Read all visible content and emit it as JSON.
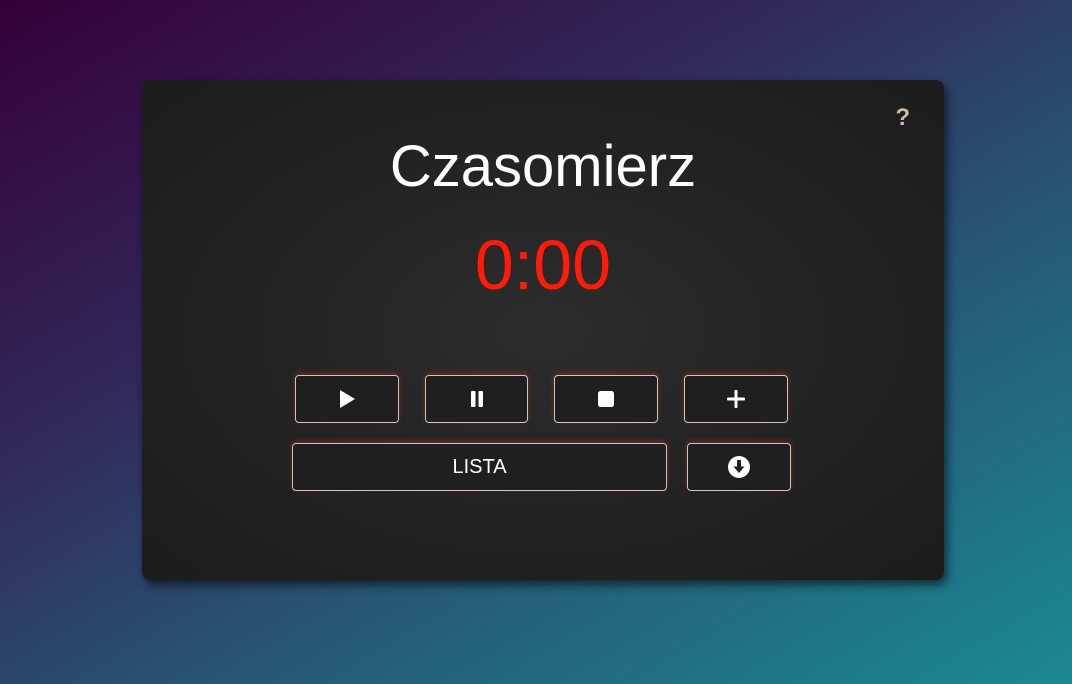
{
  "app": {
    "title": "Czasomierz",
    "time": "0:00",
    "help_label": "?"
  },
  "controls": {
    "play_icon": "play-icon",
    "pause_icon": "pause-icon",
    "stop_icon": "stop-icon",
    "add_icon": "plus-icon",
    "list_label": "LISTA",
    "download_icon": "download-circle-icon"
  },
  "colors": {
    "time_color": "#ff1a0a",
    "title_color": "#ffffff",
    "help_color": "#c9bca6",
    "card_background": "#242424",
    "button_border": "#cfc6bb"
  }
}
